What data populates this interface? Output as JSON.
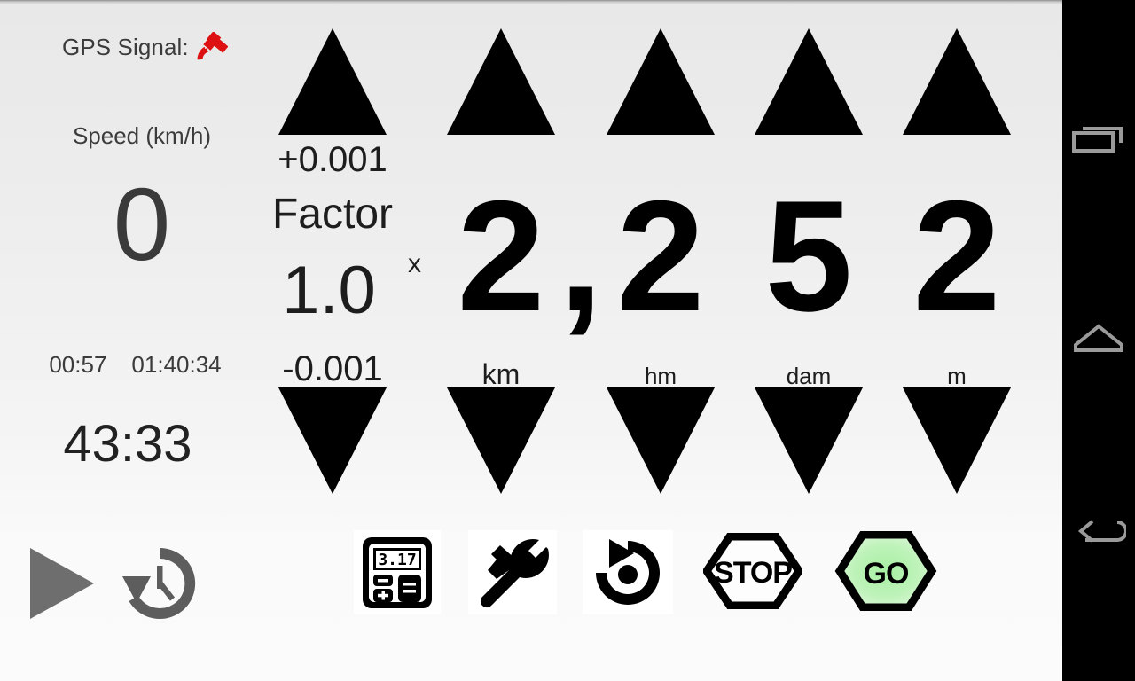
{
  "app": {
    "background_top": "#e8e8e8",
    "background_bottom": "#fbfbfb"
  },
  "status": {
    "gps_label": "GPS Signal:",
    "gps_icon": "satellite-icon",
    "gps_icon_color": "#dd1111"
  },
  "speed": {
    "label": "Speed (km/h)",
    "value": "0"
  },
  "timers": {
    "lap": "00:57",
    "total": "01:40:34",
    "main": "43:33"
  },
  "factor": {
    "increment_label": "+0.001",
    "title": "Factor",
    "value": "1.0",
    "multiplier_symbol": "x",
    "decrement_label": "-0.001"
  },
  "odometer": {
    "separator": ",",
    "columns": [
      {
        "digit": "2",
        "unit": "km",
        "up_arrow": "increment-arrow",
        "down_arrow": "decrement-arrow"
      },
      {
        "digit": "2",
        "unit": "hm",
        "up_arrow": "increment-arrow",
        "down_arrow": "decrement-arrow"
      },
      {
        "digit": "5",
        "unit": "dam",
        "up_arrow": "increment-arrow",
        "down_arrow": "decrement-arrow"
      },
      {
        "digit": "2",
        "unit": "m",
        "up_arrow": "increment-arrow",
        "down_arrow": "decrement-arrow"
      }
    ],
    "factor_arrows": {
      "up": "factor-increment-arrow",
      "down": "factor-decrement-arrow"
    }
  },
  "toolbar": {
    "play": {
      "name": "play-icon",
      "color": "#6e6e6e"
    },
    "history": {
      "name": "history-clock-icon",
      "color": "#5d5d5d"
    },
    "calculator": {
      "name": "calculator-icon",
      "display": "3.17"
    },
    "tools": {
      "name": "hammer-wrench-icon"
    },
    "reset": {
      "name": "reset-rotate-icon"
    },
    "stop": {
      "name": "stop-hexagon-button",
      "label": "STOP"
    },
    "go": {
      "name": "go-hexagon-button",
      "label": "GO",
      "fill": "#8ee88a"
    }
  },
  "navbar": {
    "recents": "recents-icon",
    "home": "home-icon",
    "back": "back-icon",
    "color": "#9a9a9a"
  }
}
